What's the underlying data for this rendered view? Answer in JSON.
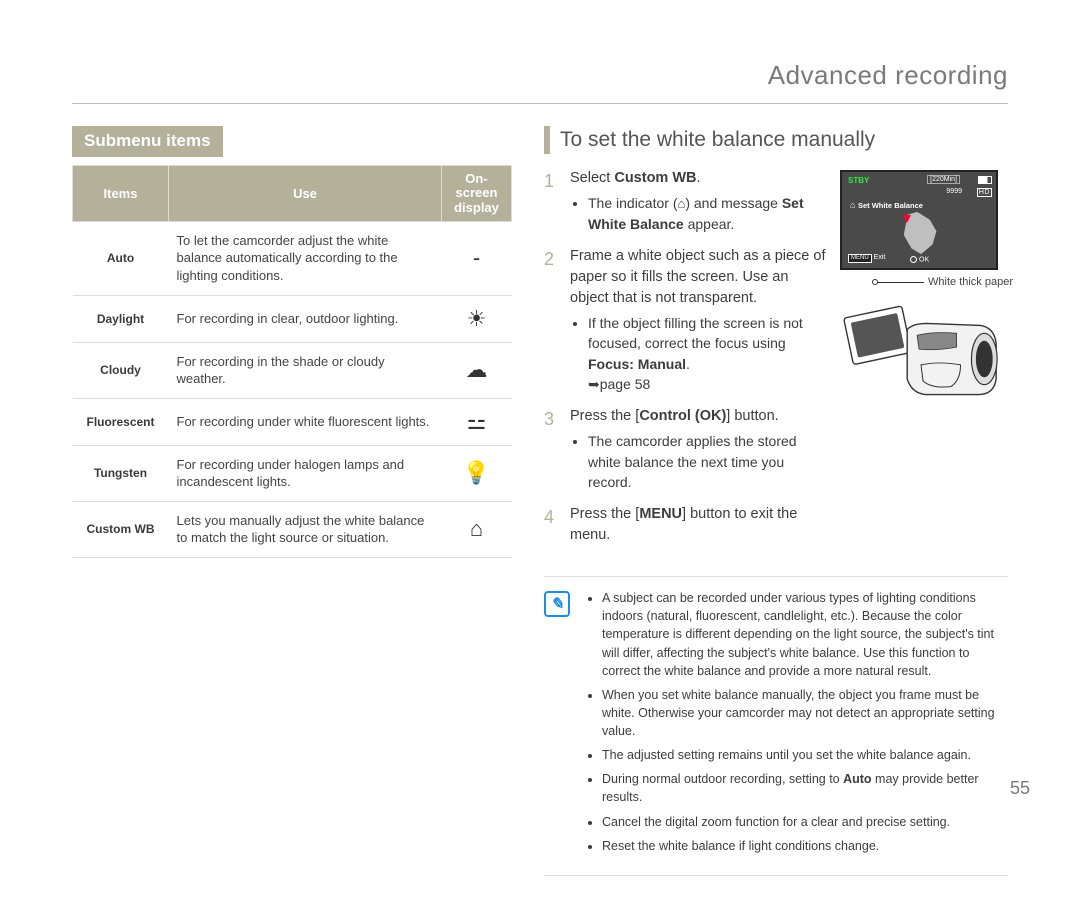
{
  "header": {
    "title": "Advanced recording"
  },
  "page_number": "55",
  "left": {
    "tab": "Submenu items",
    "th_items": "Items",
    "th_use": "Use",
    "th_display_l1": "On-screen",
    "th_display_l2": "display",
    "rows": [
      {
        "item": "Auto",
        "use": "To let the camcorder adjust the white balance automatically according to the lighting conditions.",
        "icon": "-"
      },
      {
        "item": "Daylight",
        "use": "For recording in clear, outdoor lighting.",
        "icon": "☀"
      },
      {
        "item": "Cloudy",
        "use": "For recording in the shade or cloudy weather.",
        "icon": "☁"
      },
      {
        "item": "Fluorescent",
        "use": "For recording under white fluorescent lights.",
        "icon": "⚍"
      },
      {
        "item": "Tungsten",
        "use": "For recording under halogen lamps and incandescent lights.",
        "icon": "💡"
      },
      {
        "item": "Custom WB",
        "use": "Lets you manually adjust the white balance to match the light source or situation.",
        "icon": "⌂"
      }
    ]
  },
  "right": {
    "heading": "To set the white balance manually",
    "steps": {
      "s1_a": "Select ",
      "s1_strong": "Custom WB",
      "s1_b": ".",
      "s1_sub_a": "The indicator (",
      "s1_sub_icon": "⌂",
      "s1_sub_b": ") and message ",
      "s1_sub_strong": "Set White Balance",
      "s1_sub_c": " appear.",
      "s2": "Frame a white object such as a piece of paper so it fills the screen. Use an object that is not transparent.",
      "s2_sub_a": "If the object filling the screen is not focused, correct the focus using ",
      "s2_sub_strong": "Focus: Manual",
      "s2_sub_b": ".",
      "s2_sub_ref": "page 58",
      "s3_a": "Press the [",
      "s3_strong": "Control (OK)",
      "s3_b": "] button.",
      "s3_sub": "The camcorder applies the stored white balance the next time you record.",
      "s4_a": "Press the [",
      "s4_strong": "MENU",
      "s4_b": "] button to exit the menu."
    },
    "lcd": {
      "stby": "STBY",
      "min": "[220Min]",
      "count": "9999",
      "hd": "HD",
      "swb_label": "Set White Balance",
      "menu_box": "MENU",
      "exit": "Exit",
      "ok": "OK"
    },
    "callout": "White thick paper",
    "notes": [
      {
        "t1": "A subject can be recorded under various types of lighting conditions indoors (natural, fluorescent, candlelight, etc.). Because the color temperature is different depending on the light source, the subject's tint will differ, affecting the subject's white balance. Use this function to correct the white balance and provide a more natural result."
      },
      {
        "t1": "When you set white balance manually, the object you frame must be white. Otherwise your camcorder may not detect an appropriate setting value."
      },
      {
        "t1": "The adjusted setting remains until you set the white balance again."
      },
      {
        "t1": "During normal outdoor recording, setting to ",
        "strong": "Auto",
        "t2": " may provide better results."
      },
      {
        "t1": "Cancel the digital zoom function for a clear and precise setting."
      },
      {
        "t1": "Reset the white balance if light conditions change."
      }
    ]
  }
}
